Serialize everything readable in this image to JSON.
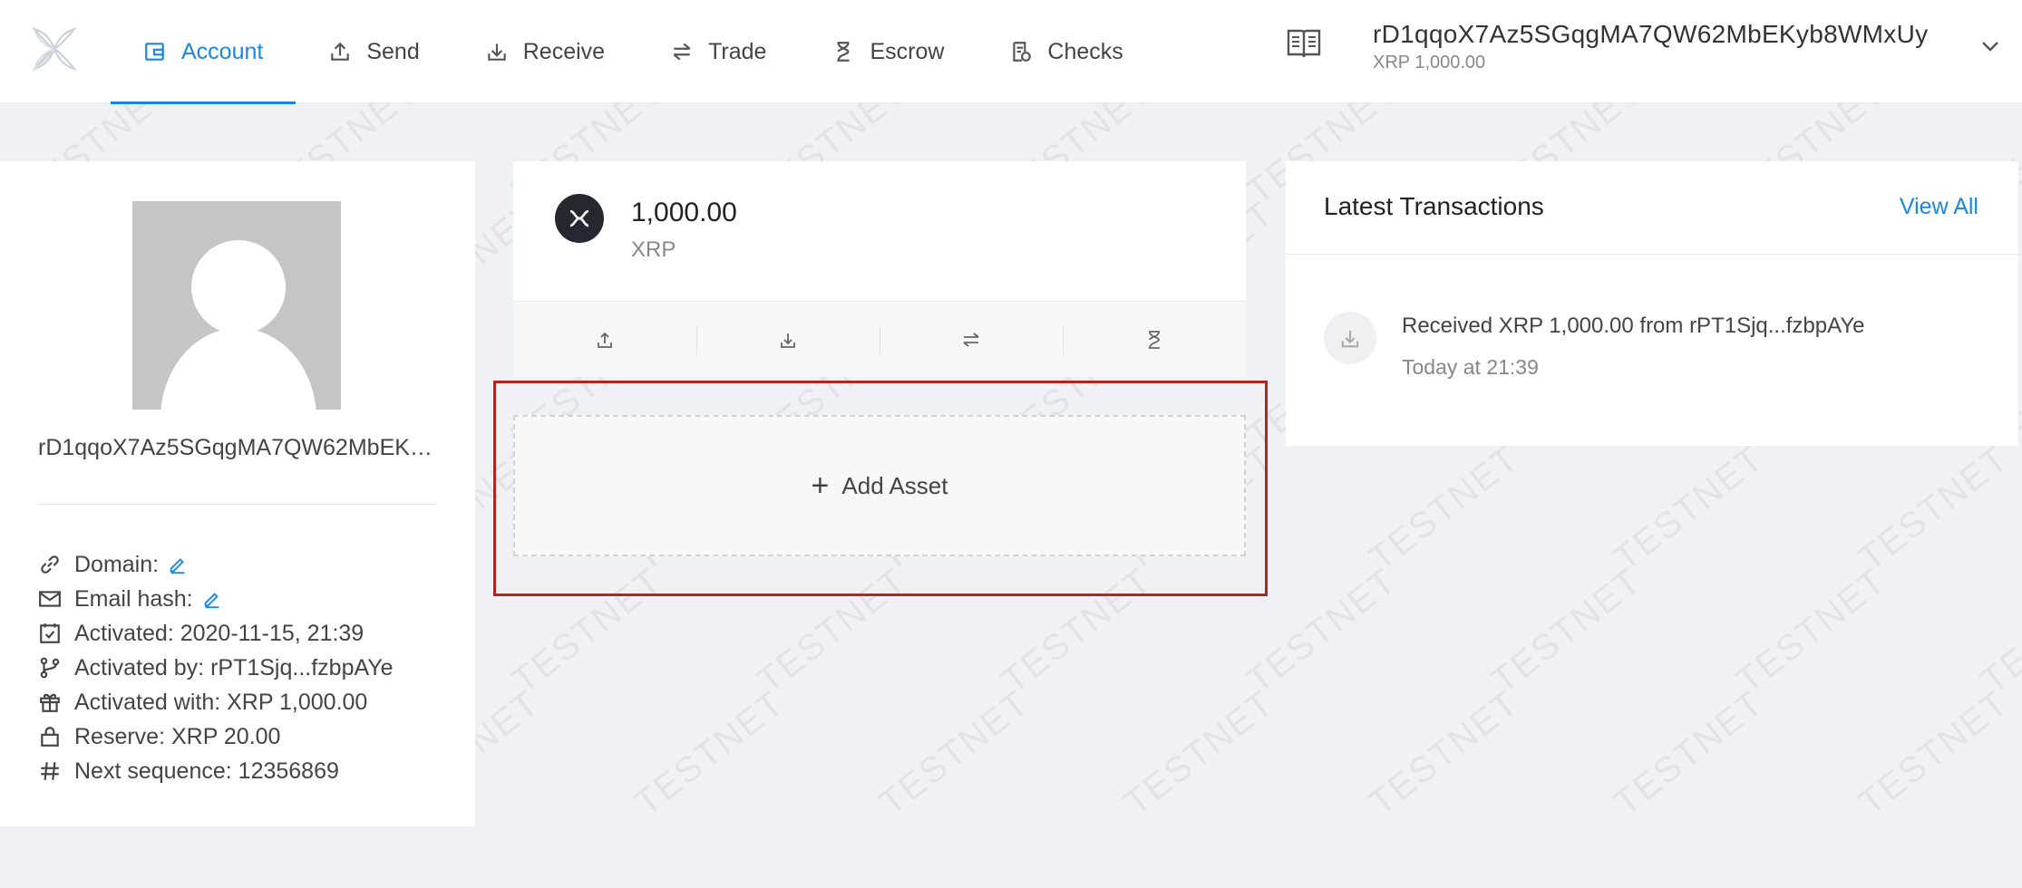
{
  "header": {
    "nav": [
      {
        "label": "Account",
        "icon": "wallet-icon",
        "active": true
      },
      {
        "label": "Send",
        "icon": "upload-icon"
      },
      {
        "label": "Receive",
        "icon": "download-icon"
      },
      {
        "label": "Trade",
        "icon": "swap-icon"
      },
      {
        "label": "Escrow",
        "icon": "hourglass-icon"
      },
      {
        "label": "Checks",
        "icon": "check-document-icon"
      }
    ],
    "account_address": "rD1qqoX7Az5SGqgMA7QW62MbEKyb8WMxUy",
    "account_balance": "XRP 1,000.00"
  },
  "watermark": "TESTNET",
  "profile": {
    "address": "rD1qqoX7Az5SGqgMA7QW62MbEKyb8WMxUy",
    "info": {
      "domain": "Domain:",
      "email_hash": "Email hash:",
      "activated": "Activated: 2020-11-15, 21:39",
      "activated_by": "Activated by: rPT1Sjq...fzbpAYe",
      "activated_with": "Activated with: XRP 1,000.00",
      "reserve": "Reserve: XRP 20.00",
      "next_sequence": "Next sequence: 12356869"
    }
  },
  "asset": {
    "amount": "1,000.00",
    "currency": "XRP"
  },
  "add_asset_label": "Add Asset",
  "transactions": {
    "title": "Latest Transactions",
    "view_all": "View All",
    "items": [
      {
        "text": "Received XRP 1,000.00 from rPT1Sjq...fzbpAYe",
        "time": "Today at 21:39"
      }
    ]
  },
  "colors": {
    "accent": "#1a86e6",
    "highlight_frame": "#b3261e",
    "background": "#f0f1f5"
  }
}
